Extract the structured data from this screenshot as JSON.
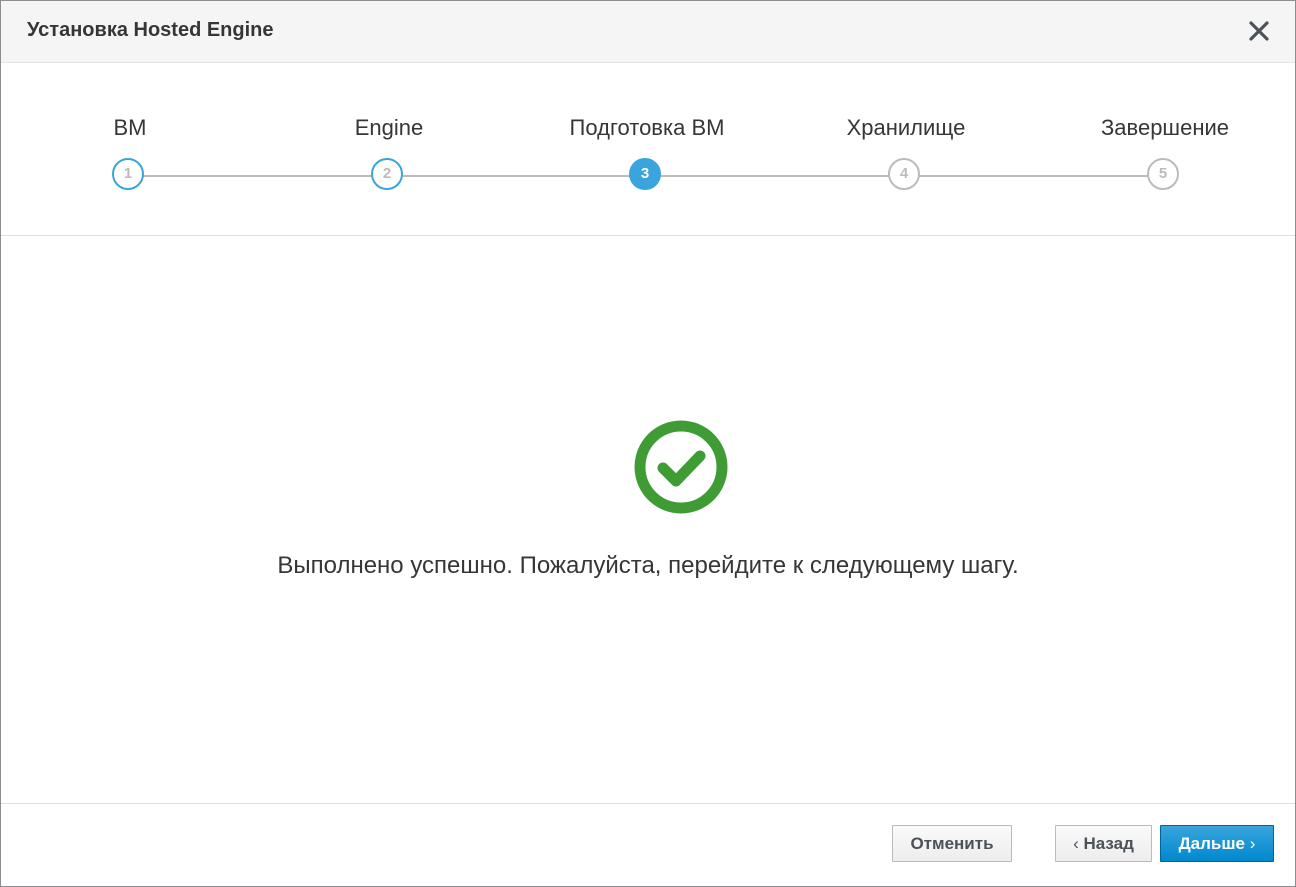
{
  "dialog": {
    "title": "Установка Hosted Engine",
    "close_icon": "close-icon"
  },
  "steps": [
    {
      "label": "ВМ",
      "number": "1",
      "state": "done"
    },
    {
      "label": "Engine",
      "number": "2",
      "state": "done"
    },
    {
      "label": "Подготовка ВМ",
      "number": "3",
      "state": "active"
    },
    {
      "label": "Хранилище",
      "number": "4",
      "state": "pending"
    },
    {
      "label": "Завершение",
      "number": "5",
      "state": "pending"
    }
  ],
  "body": {
    "icon": "success-check-icon",
    "message": "Выполнено успешно. Пожалуйста, перейдите к следующему шагу."
  },
  "footer": {
    "cancel_label": "Отменить",
    "back_label": "Назад",
    "next_label": "Дальше",
    "back_icon": "chevron-left-icon",
    "next_icon": "chevron-right-icon"
  },
  "colors": {
    "accent": "#39a5dc",
    "primary": "#0088ce",
    "success": "#3f9c35",
    "step_inactive": "#bbbbbb"
  }
}
